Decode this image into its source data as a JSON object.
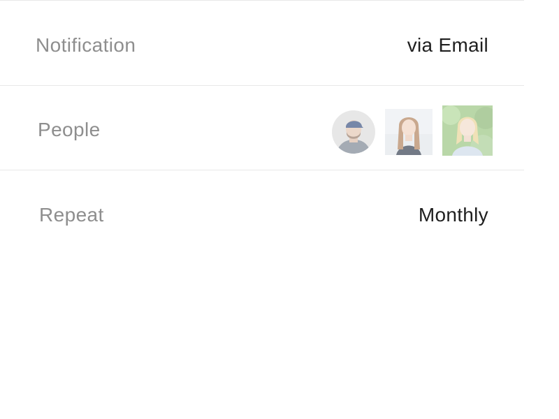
{
  "rows": [
    {
      "label": "Notification",
      "value": "via Email"
    },
    {
      "label": "People"
    },
    {
      "label": "Repeat",
      "value": "Monthly"
    }
  ],
  "people": [
    {
      "avatar": "person-in-cap-avatar"
    },
    {
      "avatar": "woman-long-hair-avatar"
    },
    {
      "avatar": "blonde-woman-avatar"
    }
  ],
  "colors": {
    "label": "#8e8e8e",
    "value": "#1f1f1f",
    "divider": "#e8e8e8",
    "background": "#ffffff"
  }
}
